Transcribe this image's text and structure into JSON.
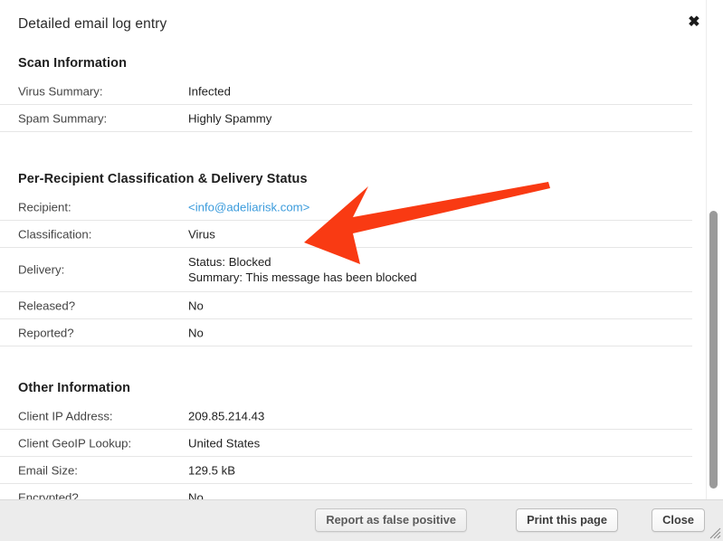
{
  "dialog": {
    "title": "Detailed email log entry",
    "close_icon": "close-icon",
    "close_glyph": "✖"
  },
  "sections": [
    {
      "heading": "Scan Information",
      "rows": [
        {
          "label": "Virus Summary:",
          "value": "Infected"
        },
        {
          "label": "Spam Summary:",
          "value": "Highly Spammy"
        }
      ]
    },
    {
      "heading": "Per-Recipient Classification & Delivery Status",
      "rows": [
        {
          "label": "Recipient:",
          "value": "<info@adeliarisk.com>"
        },
        {
          "label": "Classification:",
          "value": "Virus"
        },
        {
          "label": "Delivery:",
          "value_line1": "Status: Blocked",
          "value_line2": "Summary: This message has been blocked"
        },
        {
          "label": "Released?",
          "value": "No"
        },
        {
          "label": "Reported?",
          "value": "No"
        }
      ]
    },
    {
      "heading": "Other Information",
      "rows": [
        {
          "label": "Client IP Address:",
          "value": "209.85.214.43"
        },
        {
          "label": "Client GeoIP Lookup:",
          "value": "United States"
        },
        {
          "label": "Email Size:",
          "value": "129.5 kB"
        },
        {
          "label": "Encrypted?",
          "value": "No"
        }
      ]
    }
  ],
  "footer": {
    "report_label": "Report as false positive",
    "print_label": "Print this page",
    "close_label": "Close"
  },
  "annotation": {
    "type": "arrow",
    "color": "#f93a13",
    "points_to": "Delivery status row"
  },
  "colors": {
    "link": "#3a9bdc",
    "footer_bg": "#ececec",
    "divider": "#e6e6e6",
    "arrow": "#f93a13",
    "scroll_thumb": "#9a9a9a"
  }
}
